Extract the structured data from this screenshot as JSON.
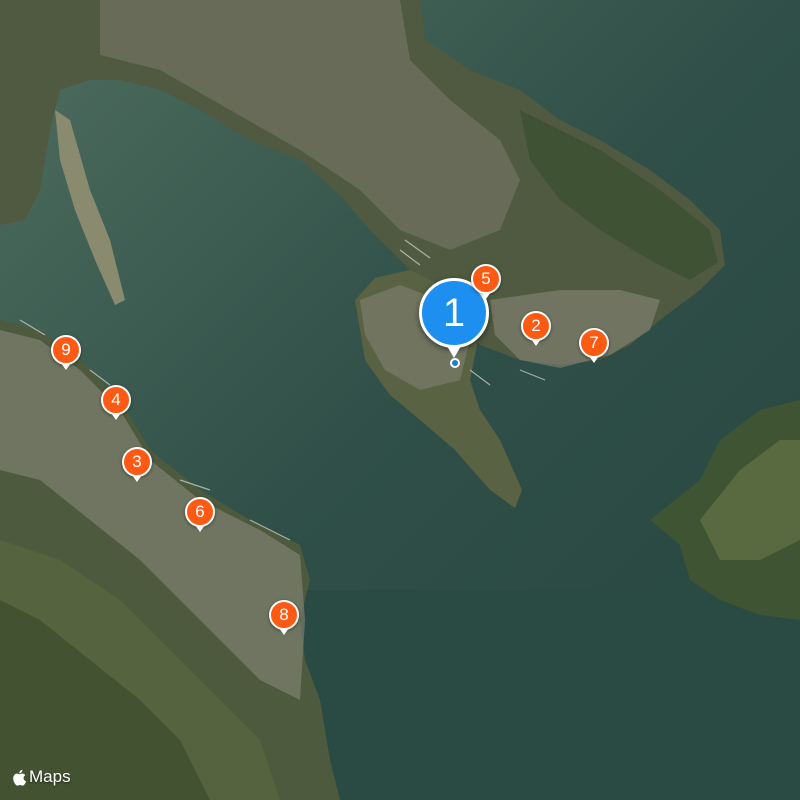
{
  "map": {
    "type": "satellite",
    "colors": {
      "water": "#2c4a45",
      "land": "#4a5a3c",
      "pin": "#ff5a14",
      "primary_pin": "#1c8ff0"
    }
  },
  "markers": [
    {
      "id": "marker-1",
      "label": "1",
      "primary": true
    },
    {
      "id": "marker-2",
      "label": "2"
    },
    {
      "id": "marker-3",
      "label": "3"
    },
    {
      "id": "marker-4",
      "label": "4"
    },
    {
      "id": "marker-5",
      "label": "5"
    },
    {
      "id": "marker-6",
      "label": "6"
    },
    {
      "id": "marker-7",
      "label": "7"
    },
    {
      "id": "marker-8",
      "label": "8"
    },
    {
      "id": "marker-9",
      "label": "9"
    }
  ],
  "attribution": {
    "icon": "apple-logo-icon",
    "text": "Maps"
  }
}
